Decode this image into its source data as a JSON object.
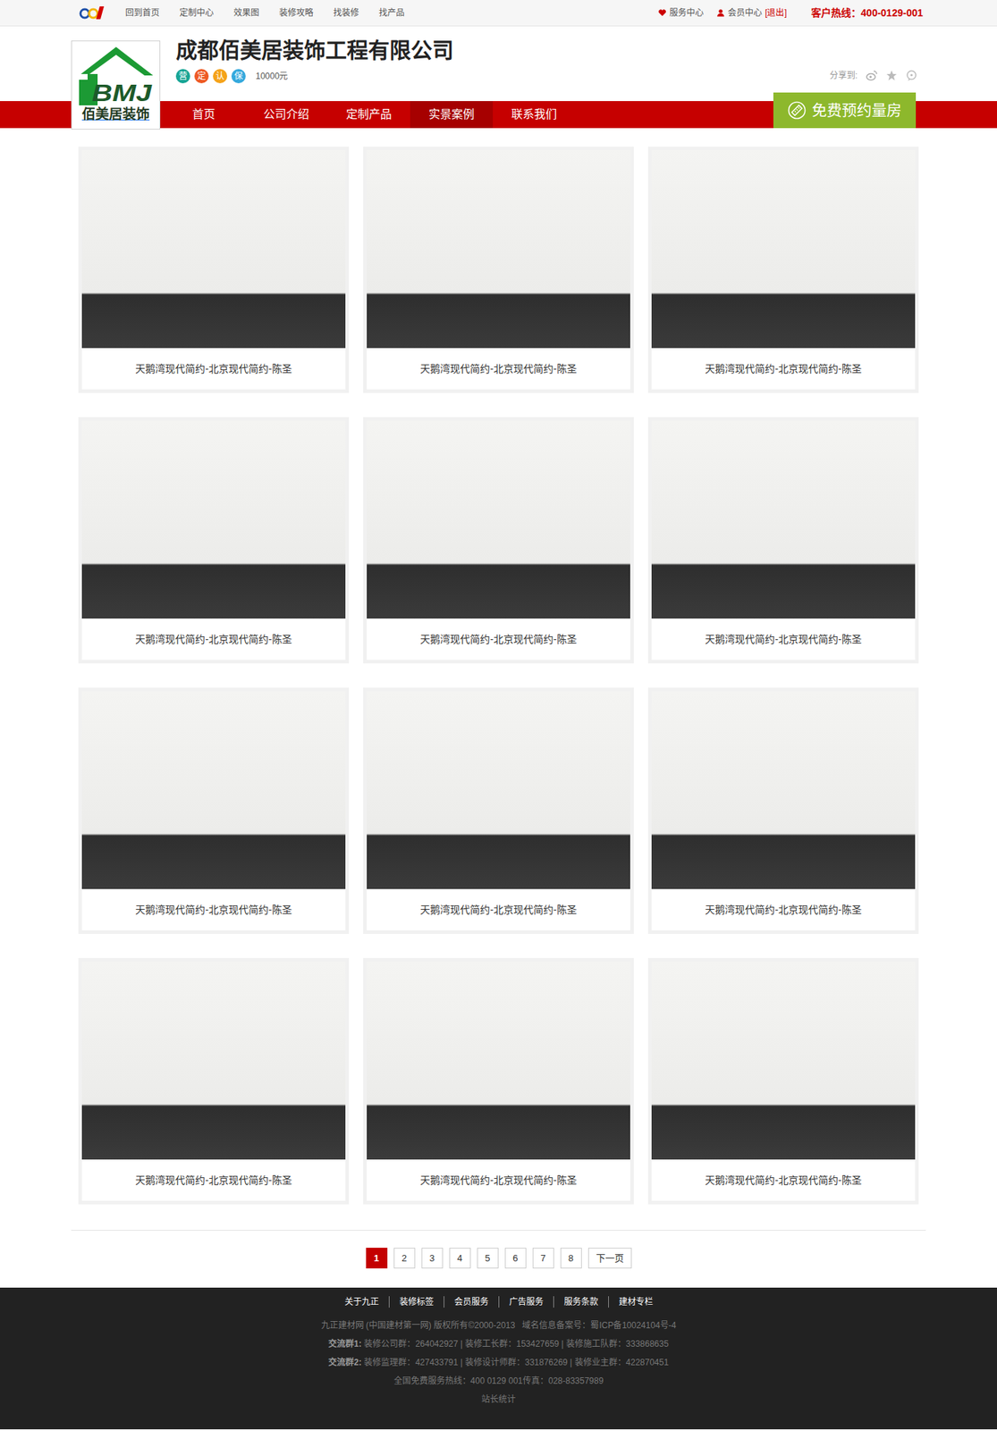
{
  "topbar": {
    "links": [
      "回到首页",
      "定制中心",
      "效果图",
      "装修攻略",
      "找装修",
      "找产品"
    ],
    "service": "服务中心",
    "member": "会员中心",
    "logout": "[退出]",
    "hotline": "客户热线：400-0129-001"
  },
  "company": {
    "logo_mark": "BMJ",
    "logo_text": "佰美居装饰",
    "name": "成都佰美居装饰工程有限公司",
    "badges": [
      {
        "label": "营",
        "color": "#17a595"
      },
      {
        "label": "定",
        "color": "#ee5a24"
      },
      {
        "label": "认",
        "color": "#f5a31a"
      },
      {
        "label": "保",
        "color": "#35a9dd"
      }
    ],
    "deposit": "10000元",
    "share_label": "分享到:"
  },
  "nav": {
    "items": [
      {
        "label": "首页",
        "selected": false
      },
      {
        "label": "公司介绍",
        "selected": false
      },
      {
        "label": "定制产品",
        "selected": false
      },
      {
        "label": "实景案例",
        "selected": true
      },
      {
        "label": "联系我们",
        "selected": false
      }
    ],
    "cta": "免费预约量房"
  },
  "cases": [
    {
      "title": "天鹅湾现代简约-北京现代简约-陈圣"
    },
    {
      "title": "天鹅湾现代简约-北京现代简约-陈圣"
    },
    {
      "title": "天鹅湾现代简约-北京现代简约-陈圣"
    },
    {
      "title": "天鹅湾现代简约-北京现代简约-陈圣"
    },
    {
      "title": "天鹅湾现代简约-北京现代简约-陈圣"
    },
    {
      "title": "天鹅湾现代简约-北京现代简约-陈圣"
    },
    {
      "title": "天鹅湾现代简约-北京现代简约-陈圣"
    },
    {
      "title": "天鹅湾现代简约-北京现代简约-陈圣"
    },
    {
      "title": "天鹅湾现代简约-北京现代简约-陈圣"
    },
    {
      "title": "天鹅湾现代简约-北京现代简约-陈圣"
    },
    {
      "title": "天鹅湾现代简约-北京现代简约-陈圣"
    },
    {
      "title": "天鹅湾现代简约-北京现代简约-陈圣"
    }
  ],
  "pagination": {
    "pages": [
      {
        "label": "1",
        "selected": true
      },
      {
        "label": "2",
        "selected": false
      },
      {
        "label": "3",
        "selected": false
      },
      {
        "label": "4",
        "selected": false
      },
      {
        "label": "5",
        "selected": false
      },
      {
        "label": "6",
        "selected": false
      },
      {
        "label": "7",
        "selected": false
      },
      {
        "label": "8",
        "selected": false
      }
    ],
    "next": "下一页"
  },
  "footer": {
    "links": [
      "关于九正",
      "装修标签",
      "会员服务",
      "广告服务",
      "服务条款",
      "建材专栏"
    ],
    "copyright": "九正建材网 (中国建材第一网) 版权所有©2000-2013   域名信息备案号：蜀ICP备10024104号-4",
    "groups": [
      {
        "label": "交流群1:",
        "text": "装修公司群：264042927 | 装修工长群：153427659 | 装修施工队群：333868635"
      },
      {
        "label": "交流群2:",
        "text": "装修监理群：427433791 | 装修设计师群：331876269 | 装修业主群：422870451"
      }
    ],
    "hotline": "全国免费服务热线：400 0129 001传真：028-83357989",
    "stats": "站长统计"
  }
}
